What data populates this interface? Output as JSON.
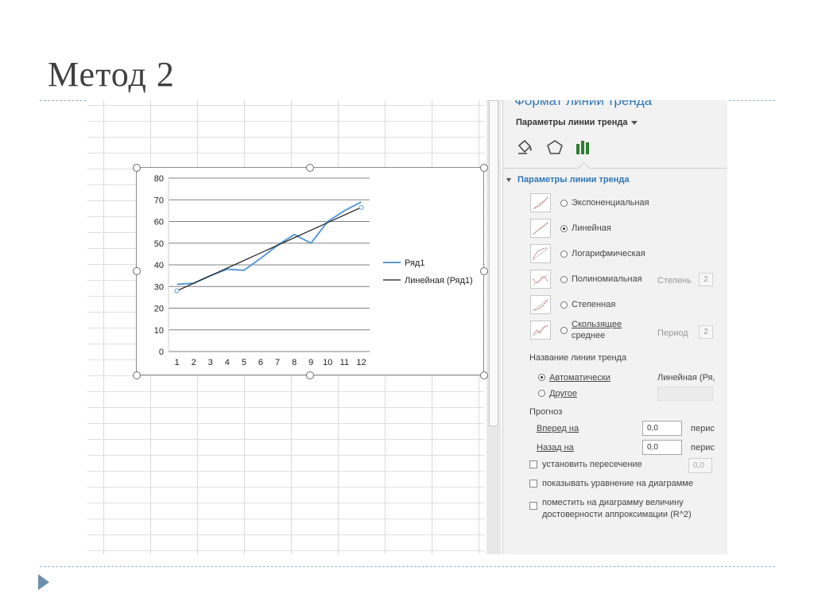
{
  "slide": {
    "title": "Метод 2"
  },
  "chart_data": {
    "type": "line",
    "categories": [
      "1",
      "2",
      "3",
      "4",
      "5",
      "6",
      "7",
      "8",
      "9",
      "10",
      "11",
      "12"
    ],
    "series": [
      {
        "name": "Ряд1",
        "values": [
          31,
          31.5,
          35,
          38,
          37.5,
          43,
          49,
          54,
          50,
          60,
          65,
          69
        ],
        "color": "#5b9bd5"
      },
      {
        "name": "Линейная (Ряд1)",
        "values": [
          28,
          31.5,
          35,
          38.5,
          42,
          45.5,
          49,
          52.5,
          56,
          59.5,
          63,
          66.5
        ],
        "color": "#1a1a1a"
      }
    ],
    "y_ticks": [
      "0",
      "10",
      "20",
      "30",
      "40",
      "50",
      "60",
      "70",
      "80"
    ],
    "ylim": [
      0,
      80
    ],
    "grid": true,
    "legend": "right"
  },
  "panel": {
    "title": "Формат линии тренда",
    "subtitle": "Параметры линии тренда",
    "tabs": [
      "fill-icon",
      "pentagon-icon",
      "bar-chart-icon"
    ],
    "section": "Параметры линии тренда",
    "options": [
      {
        "label": "Экспоненциальная",
        "checked": false
      },
      {
        "label": "Линейная",
        "checked": true
      },
      {
        "label": "Логарифмическая",
        "checked": false
      },
      {
        "label": "Полиномиальная",
        "checked": false
      },
      {
        "label": "Степенная",
        "checked": false
      },
      {
        "label": "Скользящее",
        "label2": "среднее",
        "checked": false
      }
    ],
    "degree_label": "Степень",
    "degree_value": "2",
    "period_label": "Период",
    "period_value": "2",
    "trend_name_label": "Название линии тренда",
    "auto_label": "Автоматически",
    "auto_value": "Линейная (Ря,",
    "other_label": "Другое",
    "forecast_label": "Прогноз",
    "forward_label": "Вперед на",
    "forward_value": "0,0",
    "forward_unit": "перис",
    "backward_label": "Назад на",
    "backward_value": "0,0",
    "backward_unit": "перис",
    "intercept_label": "установить пересечение",
    "intercept_value": "0,0",
    "show_equation_label": "показывать уравнение на диаграмме",
    "show_r2_line1": "поместить на диаграмму величину",
    "show_r2_line2": "достоверности аппроксимации (R^2)"
  }
}
